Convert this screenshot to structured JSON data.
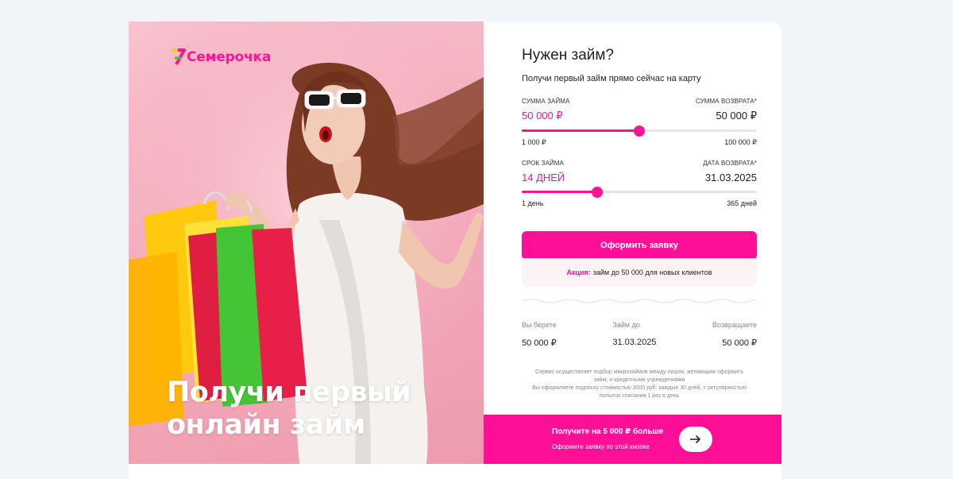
{
  "brand": {
    "name": "Семерочка",
    "accent": "#ff1493"
  },
  "hero": {
    "title": "Получи первый онлайн займ",
    "image": "woman-with-shopping-bags"
  },
  "form": {
    "title": "Нужен займ?",
    "subtitle": "Получи первый займ прямо сейчас на карту",
    "amount": {
      "label": "СУММА ЗАЙМА",
      "value": "50 000 ₽",
      "min_label": "1 000 ₽",
      "max_label": "100 000 ₽",
      "level": 0.5
    },
    "repayment": {
      "label": "СУММА ВОЗВРАТА*",
      "value": "50 000 ₽"
    },
    "term": {
      "label": "СРОК ЗАЙМА",
      "value": "14 ДНЕЙ",
      "min_label": "1 день",
      "max_label": "365 дней",
      "level": 0.32
    },
    "return_date": {
      "label": "ДАТА ВОЗВРАТА*",
      "value": "31.03.2025"
    },
    "submit_label": "Оформить заявку",
    "promo": {
      "prefix": "Акция:",
      "text": "займ до 50 000 для новых клиентов"
    }
  },
  "summary": [
    {
      "label": "Вы берете",
      "value": "50 000 ₽"
    },
    {
      "label": "Займ до",
      "value": "31.03.2025"
    },
    {
      "label": "Возвращаете",
      "value": "50 000 ₽"
    }
  ],
  "legal": {
    "line1": "Сервис осуществляет подбор микрозаймов между лицом, желающим оформить",
    "line2": "займ, и кредитными учреждениями",
    "line3": "Вы оформляете подписку стоимостью 3000 руб. каждые 30 дней, с регулярностью",
    "line4": "попыток списания 1 раз в день"
  },
  "bottom_bar": {
    "title": "Получите на 5 000 ₽ больше",
    "subtitle": "Оформите заявку по этой кнопке",
    "button_icon": "arrow-right-icon"
  }
}
